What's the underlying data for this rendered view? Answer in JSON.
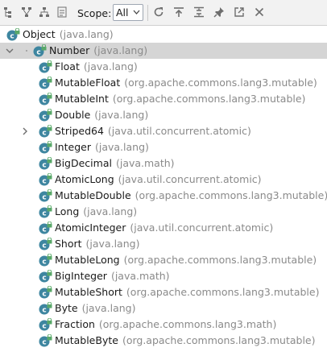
{
  "toolbar": {
    "scope_label": "Scope:",
    "scope_value": "All",
    "icons": [
      "subtypes-hierarchy-icon",
      "supertypes-hierarchy-icon",
      "class-hierarchy-icon",
      "refresh-icon",
      "pin-top-icon",
      "align-icon",
      "pin-icon",
      "export-icon",
      "close-icon"
    ]
  },
  "tree": {
    "root": {
      "name": "Object",
      "pkg": "(java.lang)"
    },
    "selected": {
      "name": "Number",
      "pkg": "(java.lang)"
    },
    "children": [
      {
        "name": "Float",
        "pkg": "(java.lang)"
      },
      {
        "name": "MutableFloat",
        "pkg": "(org.apache.commons.lang3.mutable)"
      },
      {
        "name": "MutableInt",
        "pkg": "(org.apache.commons.lang3.mutable)"
      },
      {
        "name": "Double",
        "pkg": "(java.lang)"
      },
      {
        "name": "Striped64",
        "pkg": "(java.util.concurrent.atomic)"
      },
      {
        "name": "Integer",
        "pkg": "(java.lang)"
      },
      {
        "name": "BigDecimal",
        "pkg": "(java.math)"
      },
      {
        "name": "AtomicLong",
        "pkg": "(java.util.concurrent.atomic)"
      },
      {
        "name": "MutableDouble",
        "pkg": "(org.apache.commons.lang3.mutable)"
      },
      {
        "name": "Long",
        "pkg": "(java.lang)"
      },
      {
        "name": "AtomicInteger",
        "pkg": "(java.util.concurrent.atomic)"
      },
      {
        "name": "Short",
        "pkg": "(java.lang)"
      },
      {
        "name": "MutableLong",
        "pkg": "(org.apache.commons.lang3.mutable)"
      },
      {
        "name": "BigInteger",
        "pkg": "(java.math)"
      },
      {
        "name": "MutableShort",
        "pkg": "(org.apache.commons.lang3.mutable)"
      },
      {
        "name": "Byte",
        "pkg": "(java.lang)"
      },
      {
        "name": "Fraction",
        "pkg": "(org.apache.commons.lang3.math)"
      },
      {
        "name": "MutableByte",
        "pkg": "(org.apache.commons.lang3.mutable)"
      }
    ]
  },
  "colors": {
    "class_icon_bg": "#3e86a0",
    "abstract_icon_bg": "#3e86a0",
    "lock_green": "#59a869",
    "selected_row": "#d5d5d5",
    "package_gray": "#8a8a8a"
  }
}
